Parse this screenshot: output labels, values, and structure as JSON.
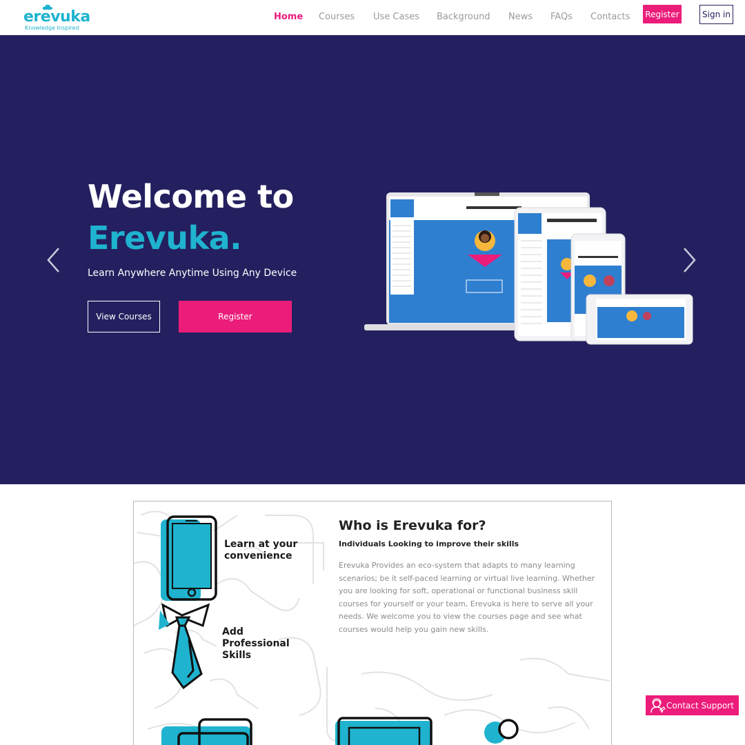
{
  "brand": {
    "name": "erevuka",
    "tagline": "Knowledge Inspired",
    "primary_color": "#1fb3cf",
    "accent_color": "#ec1c7a",
    "hero_bg": "#24205f"
  },
  "nav": {
    "items": [
      {
        "label": "Home",
        "active": true
      },
      {
        "label": "Courses",
        "active": false
      },
      {
        "label": "Use Cases",
        "active": false
      },
      {
        "label": "Background",
        "active": false
      },
      {
        "label": "News",
        "active": false
      },
      {
        "label": "FAQs",
        "active": false
      },
      {
        "label": "Contacts",
        "active": false
      }
    ],
    "register_label": "Register",
    "signin_label": "Sign in"
  },
  "hero": {
    "title_line1": "Welcome to",
    "title_line2": "Erevuka.",
    "subtitle": "Learn Anywhere Anytime Using Any Device",
    "view_courses_label": "View Courses",
    "register_label": "Register",
    "prev_icon": "chevron-left-icon",
    "next_icon": "chevron-right-icon"
  },
  "who": {
    "title": "Who is Erevuka for?",
    "subtitle": "Individuals Looking to improve their skills",
    "body": "Erevuka Provides an eco-system that adapts to many learning scenarios; be it self-paced learning or virtual live learning. Whether you are looking for soft, operational or functional business skill courses for yourself or your team, Erevuka is here to serve all your needs. We welcome you to view the courses page and see what courses would help you gain new skills.",
    "feature1": "Learn at your convenience",
    "feature2": "Add Professional Skills"
  },
  "support": {
    "label": "Contact Support",
    "icon": "support-agent-icon"
  }
}
